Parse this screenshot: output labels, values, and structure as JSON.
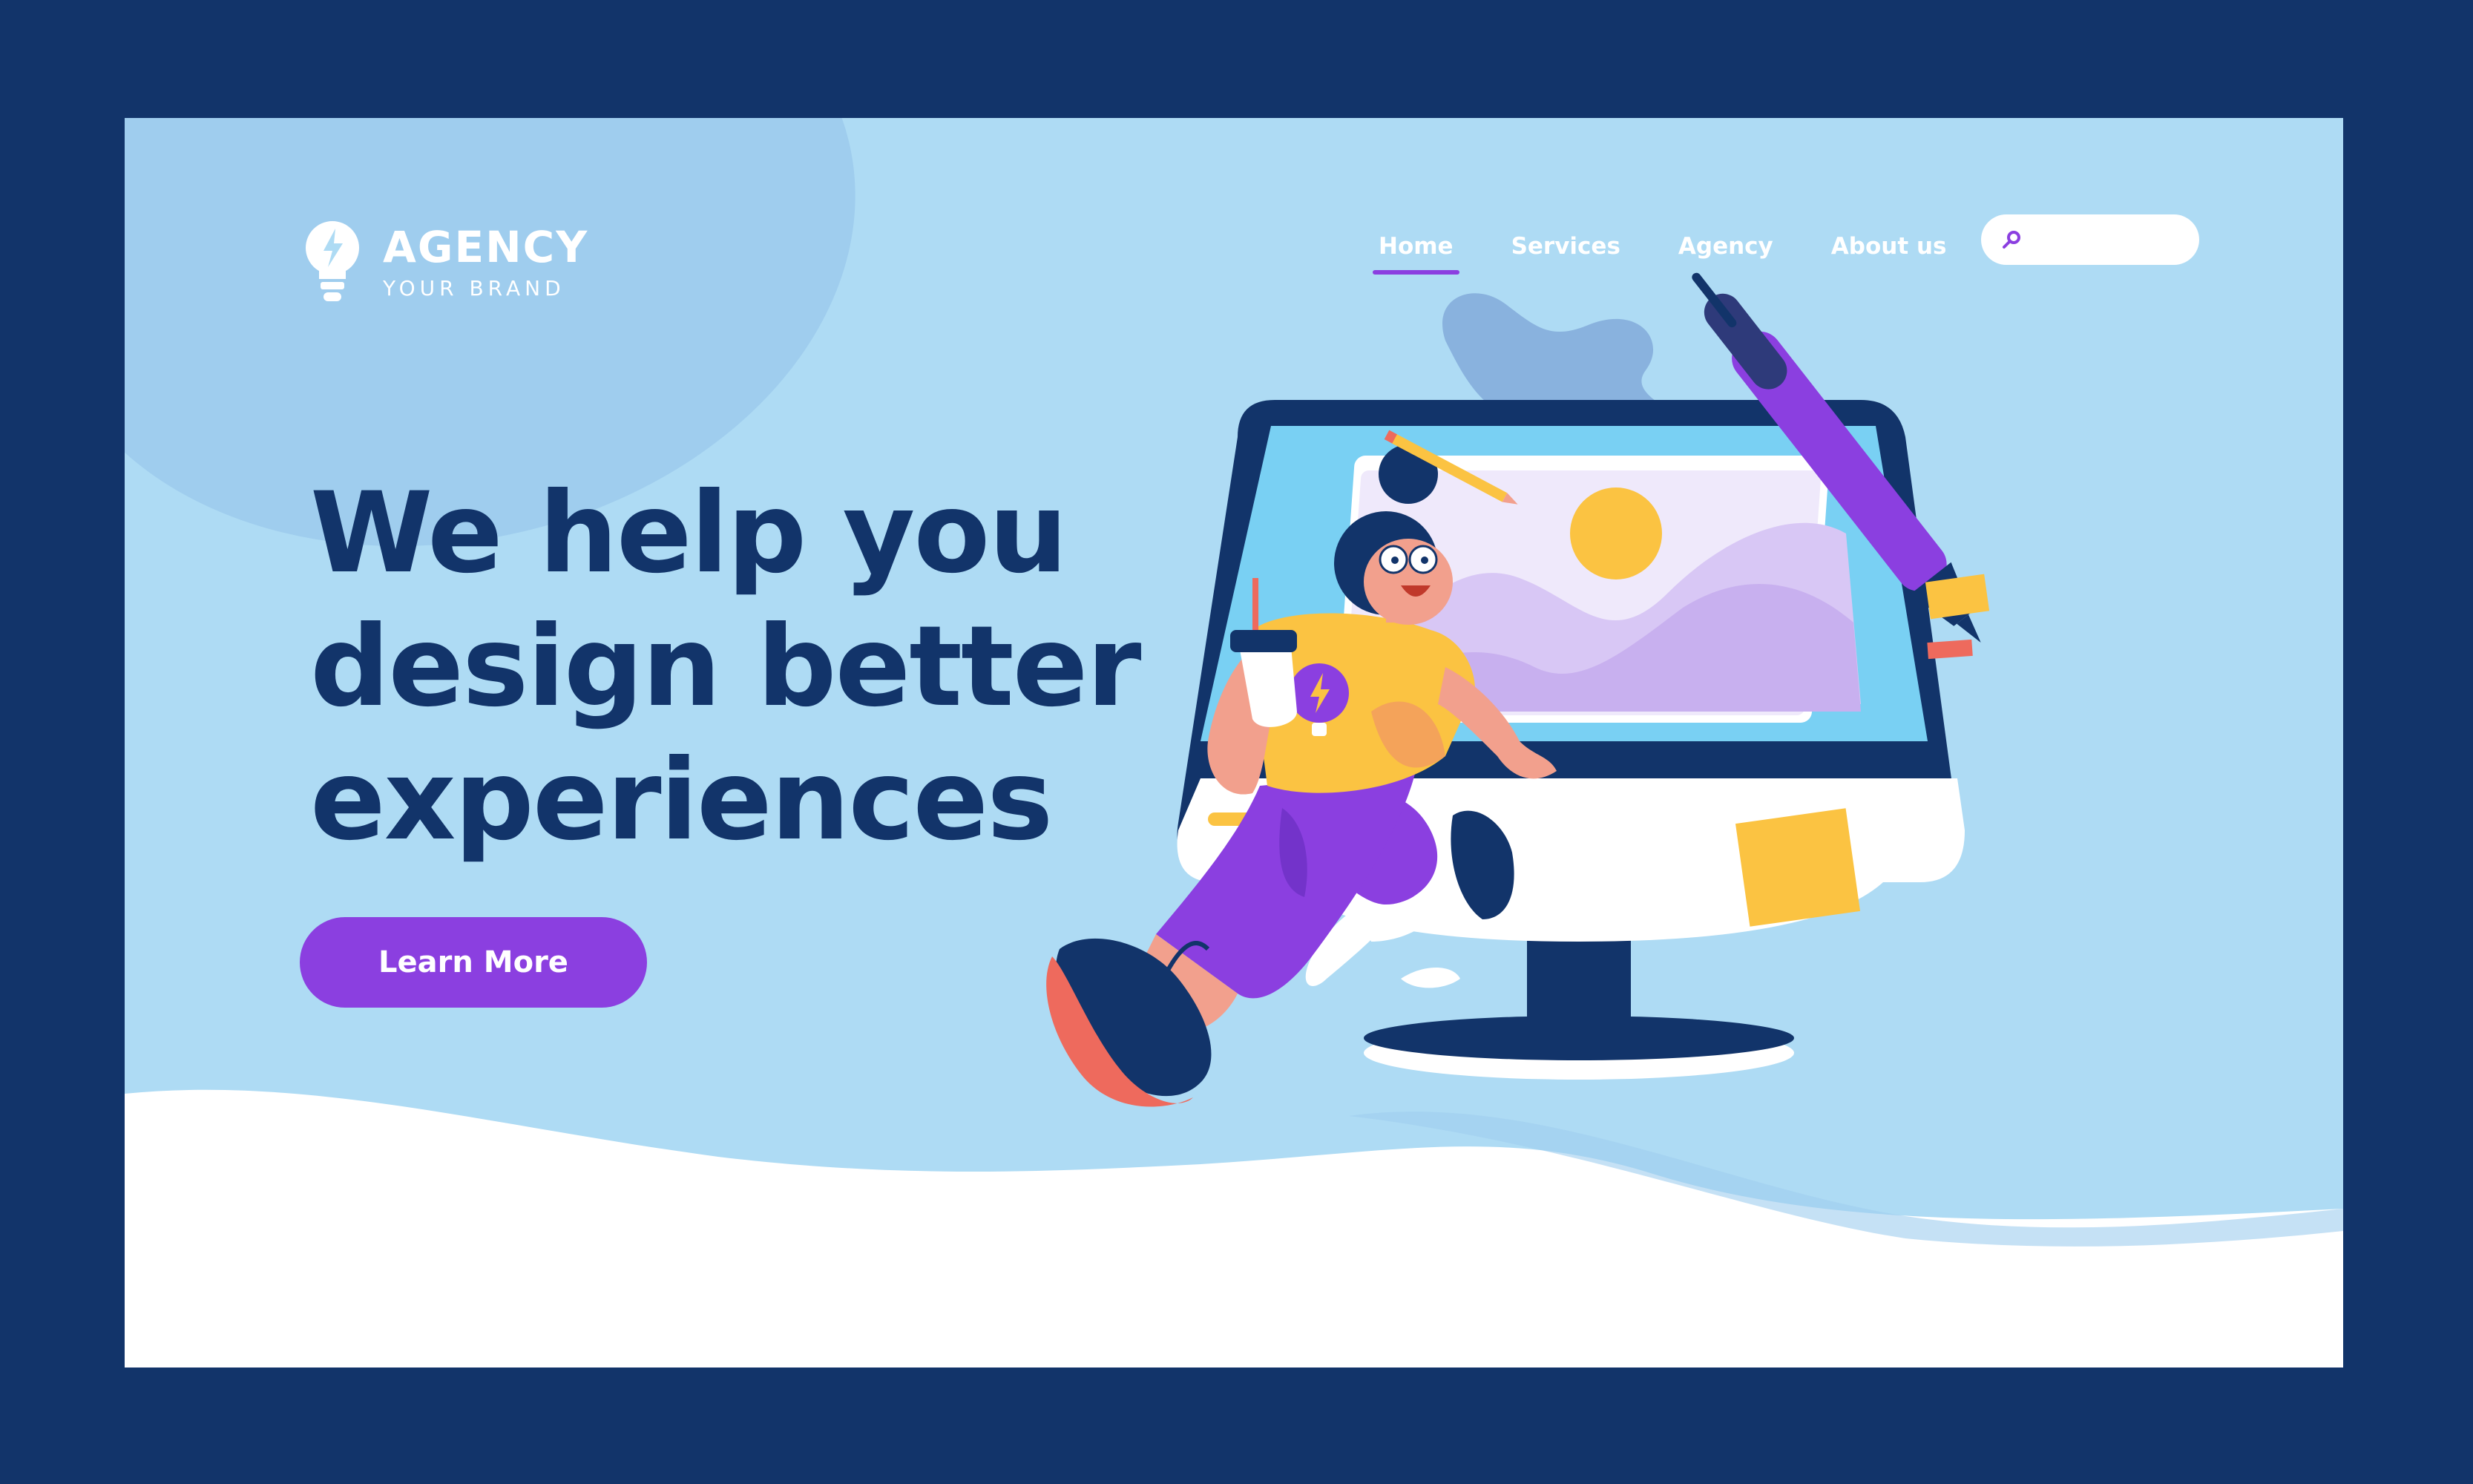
{
  "brand": {
    "name": "AGENCY",
    "tagline": "YOUR BRAND"
  },
  "nav": {
    "items": [
      {
        "label": "Home",
        "active": true
      },
      {
        "label": "Services",
        "active": false
      },
      {
        "label": "Agency",
        "active": false
      },
      {
        "label": "About us",
        "active": false
      }
    ]
  },
  "search": {
    "placeholder": "",
    "value": ""
  },
  "hero": {
    "headline_lines": [
      "We help you",
      "design better",
      "experiences"
    ],
    "cta_label": "Learn More"
  },
  "colors": {
    "frame": "#12346a",
    "background": "#aedbf4",
    "accent": "#8b3fe0",
    "headline": "#12346a",
    "yellow": "#fbc342",
    "coral": "#ee6a5d"
  },
  "icons": [
    "lightbulb-bolt-icon",
    "search-icon"
  ]
}
